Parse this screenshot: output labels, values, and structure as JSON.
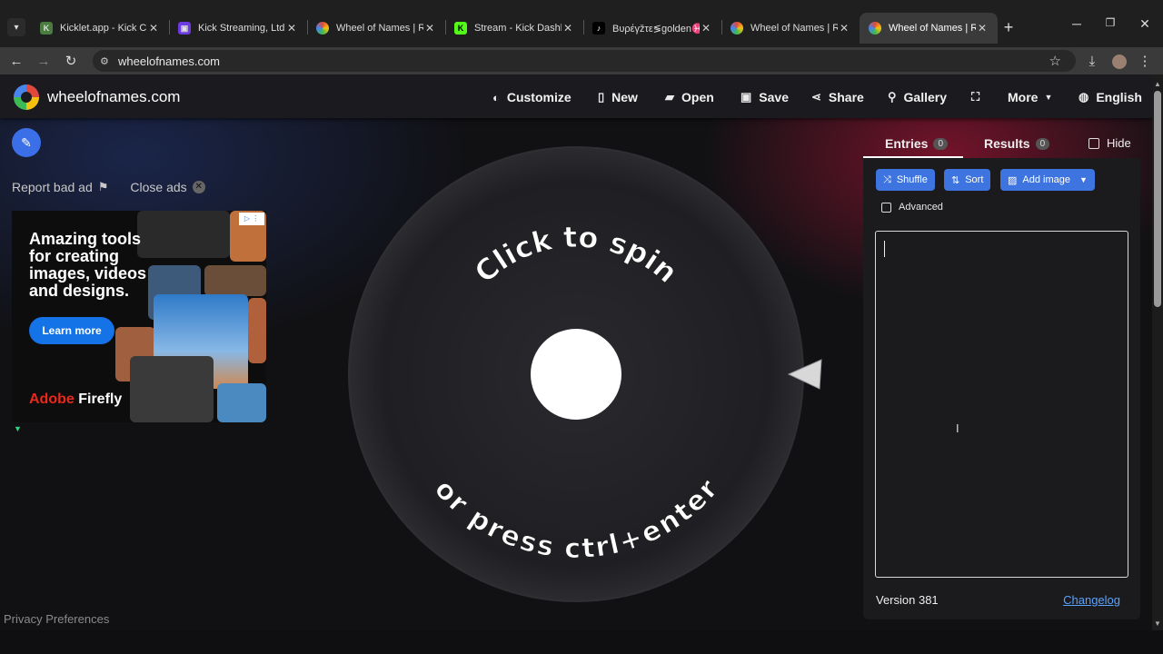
{
  "browser": {
    "tabs": [
      {
        "title": "Kicklet.app - Kick Ch",
        "favicon_color": "#4a7c3f",
        "favicon_glyph": "K"
      },
      {
        "title": "Kick Streaming, Ltd.",
        "favicon_color": "#6c3ae0",
        "favicon_glyph": "▣"
      },
      {
        "title": "Wheel of Names | Ra",
        "favicon_color": "#e0483b",
        "favicon_glyph": "●"
      },
      {
        "title": "Stream - Kick Dashb",
        "favicon_color": "#53fc18",
        "favicon_glyph": "K"
      },
      {
        "title": "Bυρέγžτε≶golden♓so",
        "favicon_color": "#000000",
        "favicon_glyph": "♪"
      },
      {
        "title": "Wheel of Names | Ra",
        "favicon_color": "#e0483b",
        "favicon_glyph": "●"
      },
      {
        "title": "Wheel of Names | Ra",
        "favicon_color": "#e0483b",
        "favicon_glyph": "●",
        "active": true
      }
    ],
    "url": "wheelofnames.com"
  },
  "nav": {
    "brand": "wheelofnames.com",
    "items": [
      {
        "label": "Customize",
        "icon": "palette-icon",
        "glyph": "🎨"
      },
      {
        "label": "New",
        "icon": "file-icon",
        "glyph": "📄"
      },
      {
        "label": "Open",
        "icon": "folder-icon",
        "glyph": "📂"
      },
      {
        "label": "Save",
        "icon": "floppy-icon",
        "glyph": "💾"
      },
      {
        "label": "Share",
        "icon": "share-icon",
        "glyph": "⤴"
      },
      {
        "label": "Gallery",
        "icon": "search-icon",
        "glyph": "🔍"
      },
      {
        "label": "",
        "icon": "fullscreen-icon",
        "glyph": "⛶"
      },
      {
        "label": "More",
        "icon": "chevron-down-icon",
        "glyph": "▼"
      },
      {
        "label": "English",
        "icon": "globe-icon",
        "glyph": "🌐"
      }
    ]
  },
  "ads": {
    "report": "Report bad ad",
    "close": "Close ads",
    "headline": "Amazing tools for creating images, videos and designs.",
    "cta": "Learn more",
    "brand_a": "Adobe",
    "brand_b": "Firefly"
  },
  "wheel": {
    "top_text": "Click to spin",
    "bottom_text": "or press ctrl+enter"
  },
  "panel": {
    "tabs": [
      {
        "label": "Entries",
        "count": "0"
      },
      {
        "label": "Results",
        "count": "0"
      }
    ],
    "hide_label": "Hide",
    "buttons": {
      "shuffle": "Shuffle",
      "sort": "Sort",
      "add_image": "Add image"
    },
    "advanced_label": "Advanced",
    "entries_value": "",
    "version": "Version 381",
    "changelog": "Changelog"
  },
  "footer": {
    "privacy": "Privacy Preferences"
  },
  "colors": {
    "accent": "#3e74e0",
    "edit": "#3a6fe8",
    "link": "#5aa3ff"
  }
}
